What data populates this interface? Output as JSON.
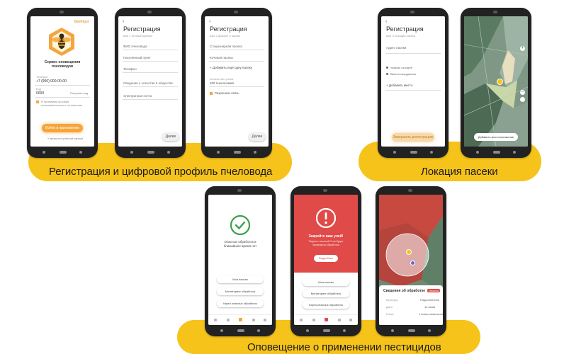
{
  "captions": {
    "registration": "Регистрация и цифровой профиль пчеловода",
    "location": "Локация пасеки",
    "warning": "Оповещение о применении пестицидов"
  },
  "phone1": {
    "brand": "BeeFigot",
    "service_title": "Сервис оповещения пчеловодов",
    "phone_label": "Телефон",
    "phone_value": "+7 (900) 000-00-00",
    "code_label": "Код",
    "code_value": "0000",
    "resend": "Получить код",
    "consent": "Я принимаю условия пользовательского соглашения",
    "primary_button": "Войти в приложение",
    "secondary_link": "У меня нет учётной записи"
  },
  "phone2": {
    "title": "Регистрация",
    "subtitle": "Шаг 1 Личные данные",
    "field1": "ФИО пчеловода",
    "field2": "Населённый пункт",
    "field3": "Телефон",
    "field4": "Сведения о членстве в обществе",
    "field5": "Электронная почта",
    "next": "Далее"
  },
  "phone3": {
    "title": "Регистрация",
    "subtitle": "Шаг 2 Данные о пасеке",
    "option1": "Стационарная пасека",
    "option2": "Кочевая пасека",
    "add_hive": "Добавить ещё одну пасеку",
    "count_label": "Количество ульев",
    "count_value": "200 пчелосемей",
    "checkbox": "Разрешаю связь",
    "next": "Далее"
  },
  "phone4": {
    "title": "Регистрация",
    "subtitle": "Шаг 3 Локация пасеки",
    "address_label": "Адрес пасеки",
    "option1": "Указать на карте",
    "option2": "Ввести координаты",
    "add_more": "Добавить место",
    "button": "Завершить регистрацию"
  },
  "phone5": {
    "map_button": "Добавить местоположение"
  },
  "phone6": {
    "title": "Опасных обработок в ближайшее время нет",
    "item1": "Моя пасека",
    "item2": "Мониторинг обработок",
    "item3": "Карта опасных обработок"
  },
  "phone7": {
    "alert_title": "Закройте ваш улей!",
    "alert_text": "Рядом с пасекой 2 км будет проведена обработка",
    "alert_button": "Подробнее",
    "item1": "Моя пасека",
    "item2": "Мониторинг обработок",
    "item3": "Карта опасных обработок"
  },
  "phone8": {
    "card_title": "Сведения об обработке",
    "badge": "Опасно",
    "row1_label": "Культура",
    "row1_value": "Подсолнечник",
    "row2_label": "Дата",
    "row2_value": "12 июня",
    "row3_label": "Класс",
    "row3_value": "1 класс опасности"
  },
  "colors": {
    "accent": "#f6c31a",
    "orange_button": "#f5a53c",
    "alert_red": "#e04a48",
    "success_green": "#3aa24a",
    "map_green": "#6f8b77",
    "danger_zone": "#c7493f"
  }
}
